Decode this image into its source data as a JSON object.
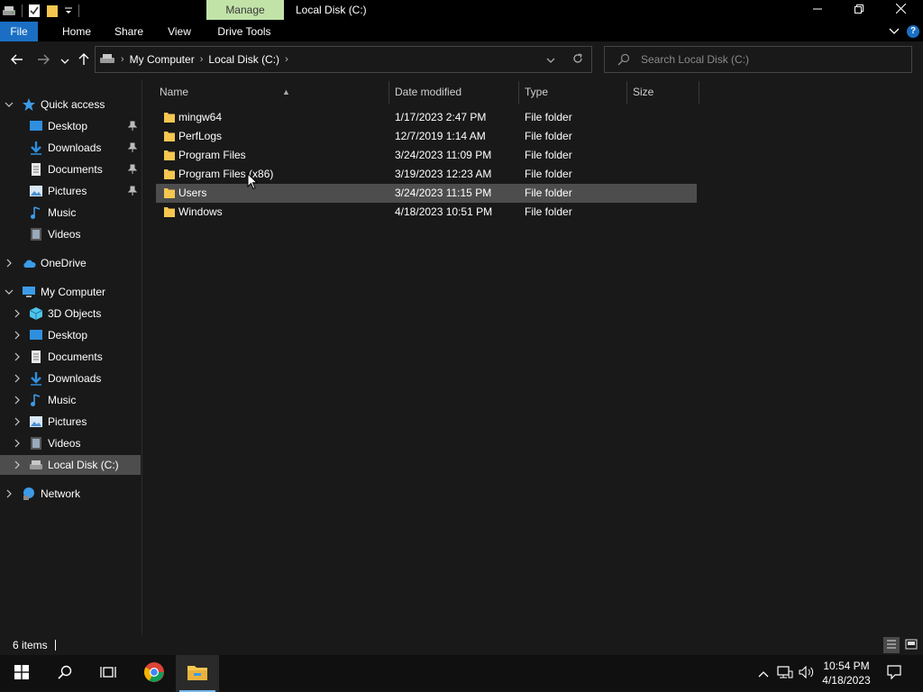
{
  "title_bar": {
    "context_tab": "Manage",
    "window_title": "Local Disk (C:)"
  },
  "ribbon": {
    "tabs": [
      "File",
      "Home",
      "Share",
      "View",
      "Drive Tools"
    ]
  },
  "address_bar": {
    "breadcrumbs": [
      "My Computer",
      "Local Disk (C:)"
    ]
  },
  "search": {
    "placeholder": "Search Local Disk (C:)"
  },
  "nav_pane": {
    "quick_access": {
      "label": "Quick access",
      "items": [
        "Desktop",
        "Downloads",
        "Documents",
        "Pictures",
        "Music",
        "Videos"
      ]
    },
    "onedrive": "OneDrive",
    "my_computer": {
      "label": "My Computer",
      "items": [
        "3D Objects",
        "Desktop",
        "Documents",
        "Downloads",
        "Music",
        "Pictures",
        "Videos",
        "Local Disk (C:)"
      ]
    },
    "network": "Network"
  },
  "file_list": {
    "columns": [
      "Name",
      "Date modified",
      "Type",
      "Size"
    ],
    "rows": [
      {
        "name": "mingw64",
        "date": "1/17/2023 2:47 PM",
        "type": "File folder"
      },
      {
        "name": "PerfLogs",
        "date": "12/7/2019 1:14 AM",
        "type": "File folder"
      },
      {
        "name": "Program Files",
        "date": "3/24/2023 11:09 PM",
        "type": "File folder"
      },
      {
        "name": "Program Files (x86)",
        "date": "3/19/2023 12:23 AM",
        "type": "File folder"
      },
      {
        "name": "Users",
        "date": "3/24/2023 11:15 PM",
        "type": "File folder"
      },
      {
        "name": "Windows",
        "date": "4/18/2023 10:51 PM",
        "type": "File folder"
      }
    ],
    "selected_row": "Users"
  },
  "status_bar": {
    "item_count": "6 items"
  },
  "taskbar": {
    "time": "10:54 PM",
    "date": "4/18/2023"
  },
  "colors": {
    "accent": "#1a6fc4",
    "manage_tab": "#c2e3a8",
    "folder": "#f5c750",
    "selection": "#4d4d4d"
  }
}
